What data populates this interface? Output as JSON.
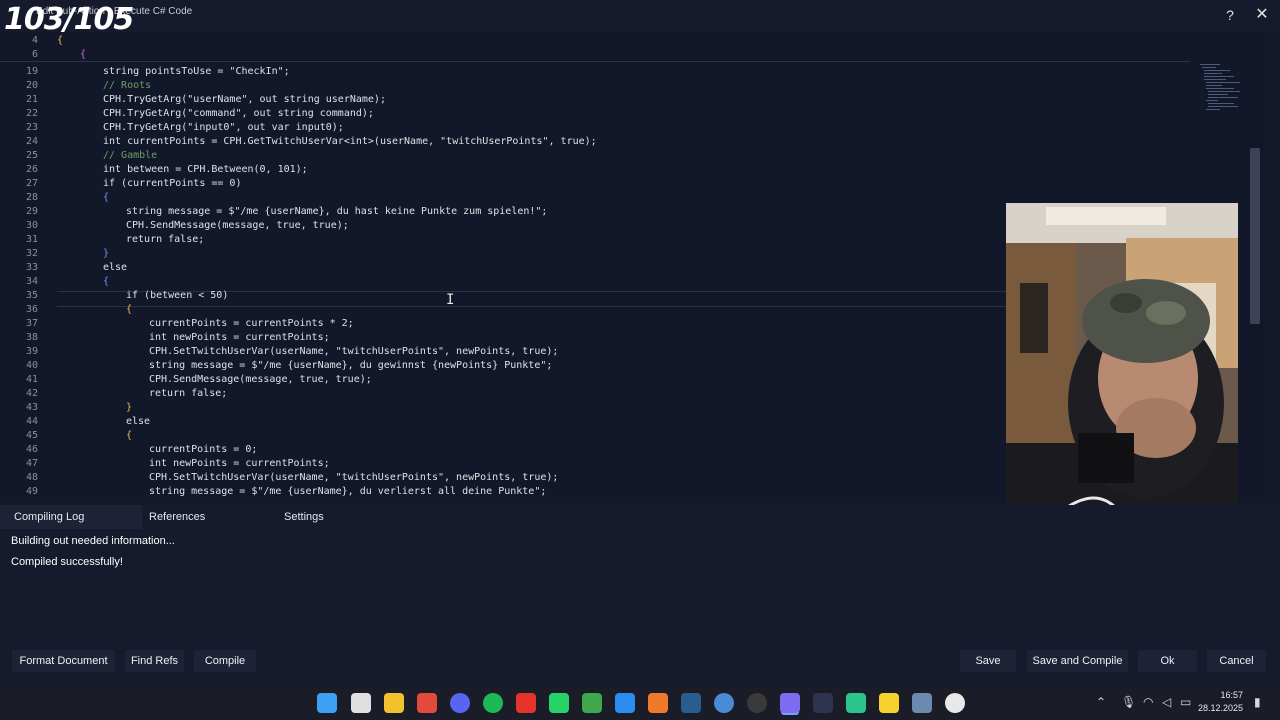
{
  "overlay_counter": "103/105",
  "window_title": "Edit Sub-Action - Execute C# Code",
  "window_controls": {
    "help": "?",
    "close": "✕"
  },
  "editor": {
    "current_line": 35,
    "lines": [
      {
        "num": "4",
        "indent": 0,
        "code": "{",
        "cls": "brace"
      },
      {
        "num": "6",
        "indent": 1,
        "code": "{",
        "cls": "brace2"
      },
      {
        "num": "19",
        "indent": 2,
        "code": "string pointsToUse = \"CheckIn\";"
      },
      {
        "num": "20",
        "indent": 2,
        "code": "// Roots",
        "cls": "cmt"
      },
      {
        "num": "21",
        "indent": 2,
        "code": "CPH.TryGetArg(\"userName\", out string userName);"
      },
      {
        "num": "22",
        "indent": 2,
        "code": "CPH.TryGetArg(\"command\", out string command);"
      },
      {
        "num": "23",
        "indent": 2,
        "code": "CPH.TryGetArg(\"input0\", out var input0);"
      },
      {
        "num": "24",
        "indent": 2,
        "code": "int currentPoints = CPH.GetTwitchUserVar<int>(userName, \"twitchUserPoints\", true);"
      },
      {
        "num": "25",
        "indent": 2,
        "code": "// Gamble",
        "cls": "cmt"
      },
      {
        "num": "26",
        "indent": 2,
        "code": "int between = CPH.Between(0, 101);"
      },
      {
        "num": "27",
        "indent": 2,
        "code": "if (currentPoints == 0)"
      },
      {
        "num": "28",
        "indent": 2,
        "code": "{",
        "cls": "kw"
      },
      {
        "num": "29",
        "indent": 3,
        "code": "string message = $\"/me {userName}, du hast keine Punkte zum spielen!\";"
      },
      {
        "num": "30",
        "indent": 3,
        "code": "CPH.SendMessage(message, true, true);"
      },
      {
        "num": "31",
        "indent": 3,
        "code": "return false;"
      },
      {
        "num": "32",
        "indent": 2,
        "code": "}",
        "cls": "kw"
      },
      {
        "num": "33",
        "indent": 2,
        "code": "else"
      },
      {
        "num": "34",
        "indent": 2,
        "code": "{",
        "cls": "kw"
      },
      {
        "num": "35",
        "indent": 3,
        "code": "if (between < 50)"
      },
      {
        "num": "36",
        "indent": 3,
        "code": "{",
        "cls": "brace"
      },
      {
        "num": "37",
        "indent": 4,
        "code": "currentPoints = currentPoints * 2;"
      },
      {
        "num": "38",
        "indent": 4,
        "code": "int newPoints = currentPoints;"
      },
      {
        "num": "39",
        "indent": 4,
        "code": "CPH.SetTwitchUserVar(userName, \"twitchUserPoints\", newPoints, true);"
      },
      {
        "num": "40",
        "indent": 4,
        "code": "string message = $\"/me {userName}, du gewinnst {newPoints} Punkte\";"
      },
      {
        "num": "41",
        "indent": 4,
        "code": "CPH.SendMessage(message, true, true);"
      },
      {
        "num": "42",
        "indent": 4,
        "code": "return false;"
      },
      {
        "num": "43",
        "indent": 3,
        "code": "}",
        "cls": "brace"
      },
      {
        "num": "44",
        "indent": 3,
        "code": "else"
      },
      {
        "num": "45",
        "indent": 3,
        "code": "{",
        "cls": "brace"
      },
      {
        "num": "46",
        "indent": 4,
        "code": "currentPoints = 0;"
      },
      {
        "num": "47",
        "indent": 4,
        "code": "int newPoints = currentPoints;"
      },
      {
        "num": "48",
        "indent": 4,
        "code": "CPH.SetTwitchUserVar(userName, \"twitchUserPoints\", newPoints, true);"
      },
      {
        "num": "49",
        "indent": 4,
        "code": "string message = $\"/me {userName}, du verlierst all deine Punkte\";"
      }
    ]
  },
  "tabs": {
    "compiling_log": "Compiling Log",
    "references": "References",
    "settings": "Settings"
  },
  "log": {
    "line1": "Building out needed information...",
    "line2": "Compiled successfully!"
  },
  "buttons": {
    "format_document": "Format Document",
    "find_refs": "Find Refs",
    "compile": "Compile",
    "save": "Save",
    "save_and_compile": "Save and Compile",
    "ok": "Ok",
    "cancel": "Cancel"
  },
  "taskbar": {
    "icons": [
      "windows-start-icon",
      "search-icon",
      "file-explorer-icon",
      "chrome-icon",
      "discord-icon",
      "spotify-icon",
      "app-red-icon",
      "whatsapp-icon",
      "notepad-green-icon",
      "vscode-icon",
      "app-orange-icon",
      "steam-icon",
      "app-blue-round-icon",
      "obs-icon",
      "streamerbot-icon",
      "audio-app-icon",
      "app-green-icon",
      "sticky-notes-icon",
      "app-multicolor-icon",
      "chatgpt-icon"
    ],
    "time": "16:57",
    "date": "28.12.2025"
  },
  "colors": {
    "keyword": "#6d96ff",
    "string": "#e58a67",
    "comment": "#6aa064",
    "brace": "#e8c34a",
    "background": "#141828"
  }
}
